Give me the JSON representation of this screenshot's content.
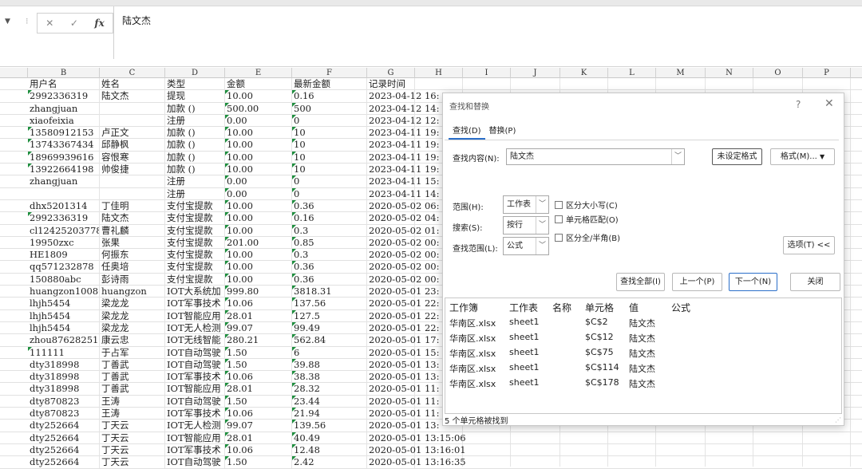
{
  "formula_bar": {
    "cancel": "✕",
    "confirm": "✓",
    "fx": "fx",
    "content": "陆文杰"
  },
  "columns": [
    "B",
    "C",
    "D",
    "E",
    "F",
    "G",
    "H",
    "I",
    "J",
    "K",
    "L",
    "M",
    "N",
    "O",
    "P"
  ],
  "rows": [
    [
      "用户名",
      "姓名",
      "类型",
      "金额",
      "最新金额",
      "记录时间"
    ],
    [
      "2992336319",
      "陆文杰",
      "提现",
      "10.00",
      "0.16",
      "2023-04-12 16:"
    ],
    [
      "zhangjuan",
      "",
      "加款 ()",
      "500.00",
      "500",
      "2023-04-12 14:"
    ],
    [
      "xiaofeixia",
      "",
      "注册",
      "0.00",
      "0",
      "2023-04-12 12:"
    ],
    [
      "13580912153",
      "卢正文",
      "加款 ()",
      "10.00",
      "10",
      "2023-04-11 19:"
    ],
    [
      "13743367434",
      "邱静枫",
      "加款 ()",
      "10.00",
      "10",
      "2023-04-11 19:"
    ],
    [
      "18969939616",
      "容恨寒",
      "加款 ()",
      "10.00",
      "10",
      "2023-04-11 19:"
    ],
    [
      "13922664198",
      "帅俊捷",
      "加款 ()",
      "10.00",
      "10",
      "2023-04-11 19:"
    ],
    [
      "zhangjuan",
      "",
      "注册",
      "0.00",
      "0",
      "2023-04-11 15:"
    ],
    [
      "",
      "",
      "注册",
      "0.00",
      "0",
      "2023-04-11 14:"
    ],
    [
      "dhx5201314",
      "丁佳明",
      "支付宝提款",
      "10.00",
      "0.36",
      "2020-05-02 06:"
    ],
    [
      "2992336319",
      "陆文杰",
      "支付宝提款",
      "10.00",
      "0.16",
      "2020-05-02 04:"
    ],
    [
      "cl12425203778",
      "曹礼麟",
      "支付宝提款",
      "10.00",
      "0.3",
      "2020-05-02 01:"
    ],
    [
      "19950zxc",
      "张果",
      "支付宝提款",
      "201.00",
      "0.85",
      "2020-05-02 00:"
    ],
    [
      "HE1809",
      "何振东",
      "支付宝提款",
      "10.00",
      "0.3",
      "2020-05-02 00:"
    ],
    [
      "qq571232878",
      "任奥培",
      "支付宝提款",
      "10.00",
      "0.36",
      "2020-05-02 00:"
    ],
    [
      "150880abc",
      "彭诗雨",
      "支付宝提款",
      "10.00",
      "0.36",
      "2020-05-02 00:"
    ],
    [
      "huangzon10086",
      "huangzon",
      "IOT大系统加",
      "999.80",
      "3818.31",
      "2020-05-01 23:"
    ],
    [
      "lhjh5454",
      "梁龙龙",
      "IOT军事技术",
      "10.06",
      "137.56",
      "2020-05-01 22:"
    ],
    [
      "lhjh5454",
      "梁龙龙",
      "IOT智能应用",
      "28.01",
      "127.5",
      "2020-05-01 22:"
    ],
    [
      "lhjh5454",
      "梁龙龙",
      "IOT无人检测",
      "99.07",
      "99.49",
      "2020-05-01 22:"
    ],
    [
      "zhou876282511",
      "康云忠",
      "IOT无线智能",
      "280.21",
      "562.84",
      "2020-05-01 17:"
    ],
    [
      "111111",
      "于占军",
      "IOT自动驾驶",
      "1.50",
      "6",
      "2020-05-01 15:"
    ],
    [
      "dty318998",
      "丁善武",
      "IOT自动驾驶",
      "1.50",
      "39.88",
      "2020-05-01 13:"
    ],
    [
      "dty318998",
      "丁善武",
      "IOT军事技术",
      "10.06",
      "38.38",
      "2020-05-01 13:"
    ],
    [
      "dty318998",
      "丁善武",
      "IOT智能应用",
      "28.01",
      "28.32",
      "2020-05-01 11:"
    ],
    [
      "dty870823",
      "王涛",
      "IOT自动驾驶",
      "1.50",
      "23.44",
      "2020-05-01 11:"
    ],
    [
      "dty870823",
      "王涛",
      "IOT军事技术",
      "10.06",
      "21.94",
      "2020-05-01 11:"
    ],
    [
      "dty252664",
      "丁天云",
      "IOT无人检测",
      "99.07",
      "139.56",
      "2020-05-01 13:"
    ],
    [
      "dty252664",
      "丁天云",
      "IOT智能应用",
      "28.01",
      "40.49",
      "2020-05-01 13:15:06"
    ],
    [
      "dty252664",
      "丁天云",
      "IOT军事技术",
      "10.06",
      "12.48",
      "2020-05-01 13:16:01"
    ],
    [
      "dty252664",
      "丁天云",
      "IOT自动驾驶",
      "1.50",
      "2.42",
      "2020-05-01 13:16:35"
    ]
  ],
  "dialog": {
    "title": "查找和替换",
    "help": "?",
    "close": "✕",
    "tab_find": "查找(D)",
    "tab_replace": "替换(P)",
    "find_label": "查找内容(N):",
    "find_value": "陆文杰",
    "no_format": "未设定格式",
    "format_btn": "格式(M)...",
    "within_label": "范围(H):",
    "within_value": "工作表",
    "search_label": "搜索(S):",
    "search_value": "按行",
    "lookin_label": "查找范围(L):",
    "lookin_value": "公式",
    "match_case": "区分大小写(C)",
    "match_cell": "单元格匹配(O)",
    "match_width": "区分全/半角(B)",
    "options_btn": "选项(T) <<",
    "find_all_btn": "查找全部(I)",
    "prev_btn": "上一个(P)",
    "next_btn": "下一个(N)",
    "close_btn": "关闭",
    "result_headers": [
      "工作簿",
      "工作表",
      "名称",
      "单元格",
      "值",
      "公式"
    ],
    "results": [
      [
        "华南区.xlsx",
        "sheet1",
        "",
        "$C$2",
        "陆文杰",
        ""
      ],
      [
        "华南区.xlsx",
        "sheet1",
        "",
        "$C$12",
        "陆文杰",
        ""
      ],
      [
        "华南区.xlsx",
        "sheet1",
        "",
        "$C$75",
        "陆文杰",
        ""
      ],
      [
        "华南区.xlsx",
        "sheet1",
        "",
        "$C$114",
        "陆文杰",
        ""
      ],
      [
        "华南区.xlsx",
        "sheet1",
        "",
        "$C$178",
        "陆文杰",
        ""
      ]
    ],
    "status": "5 个单元格被找到"
  }
}
